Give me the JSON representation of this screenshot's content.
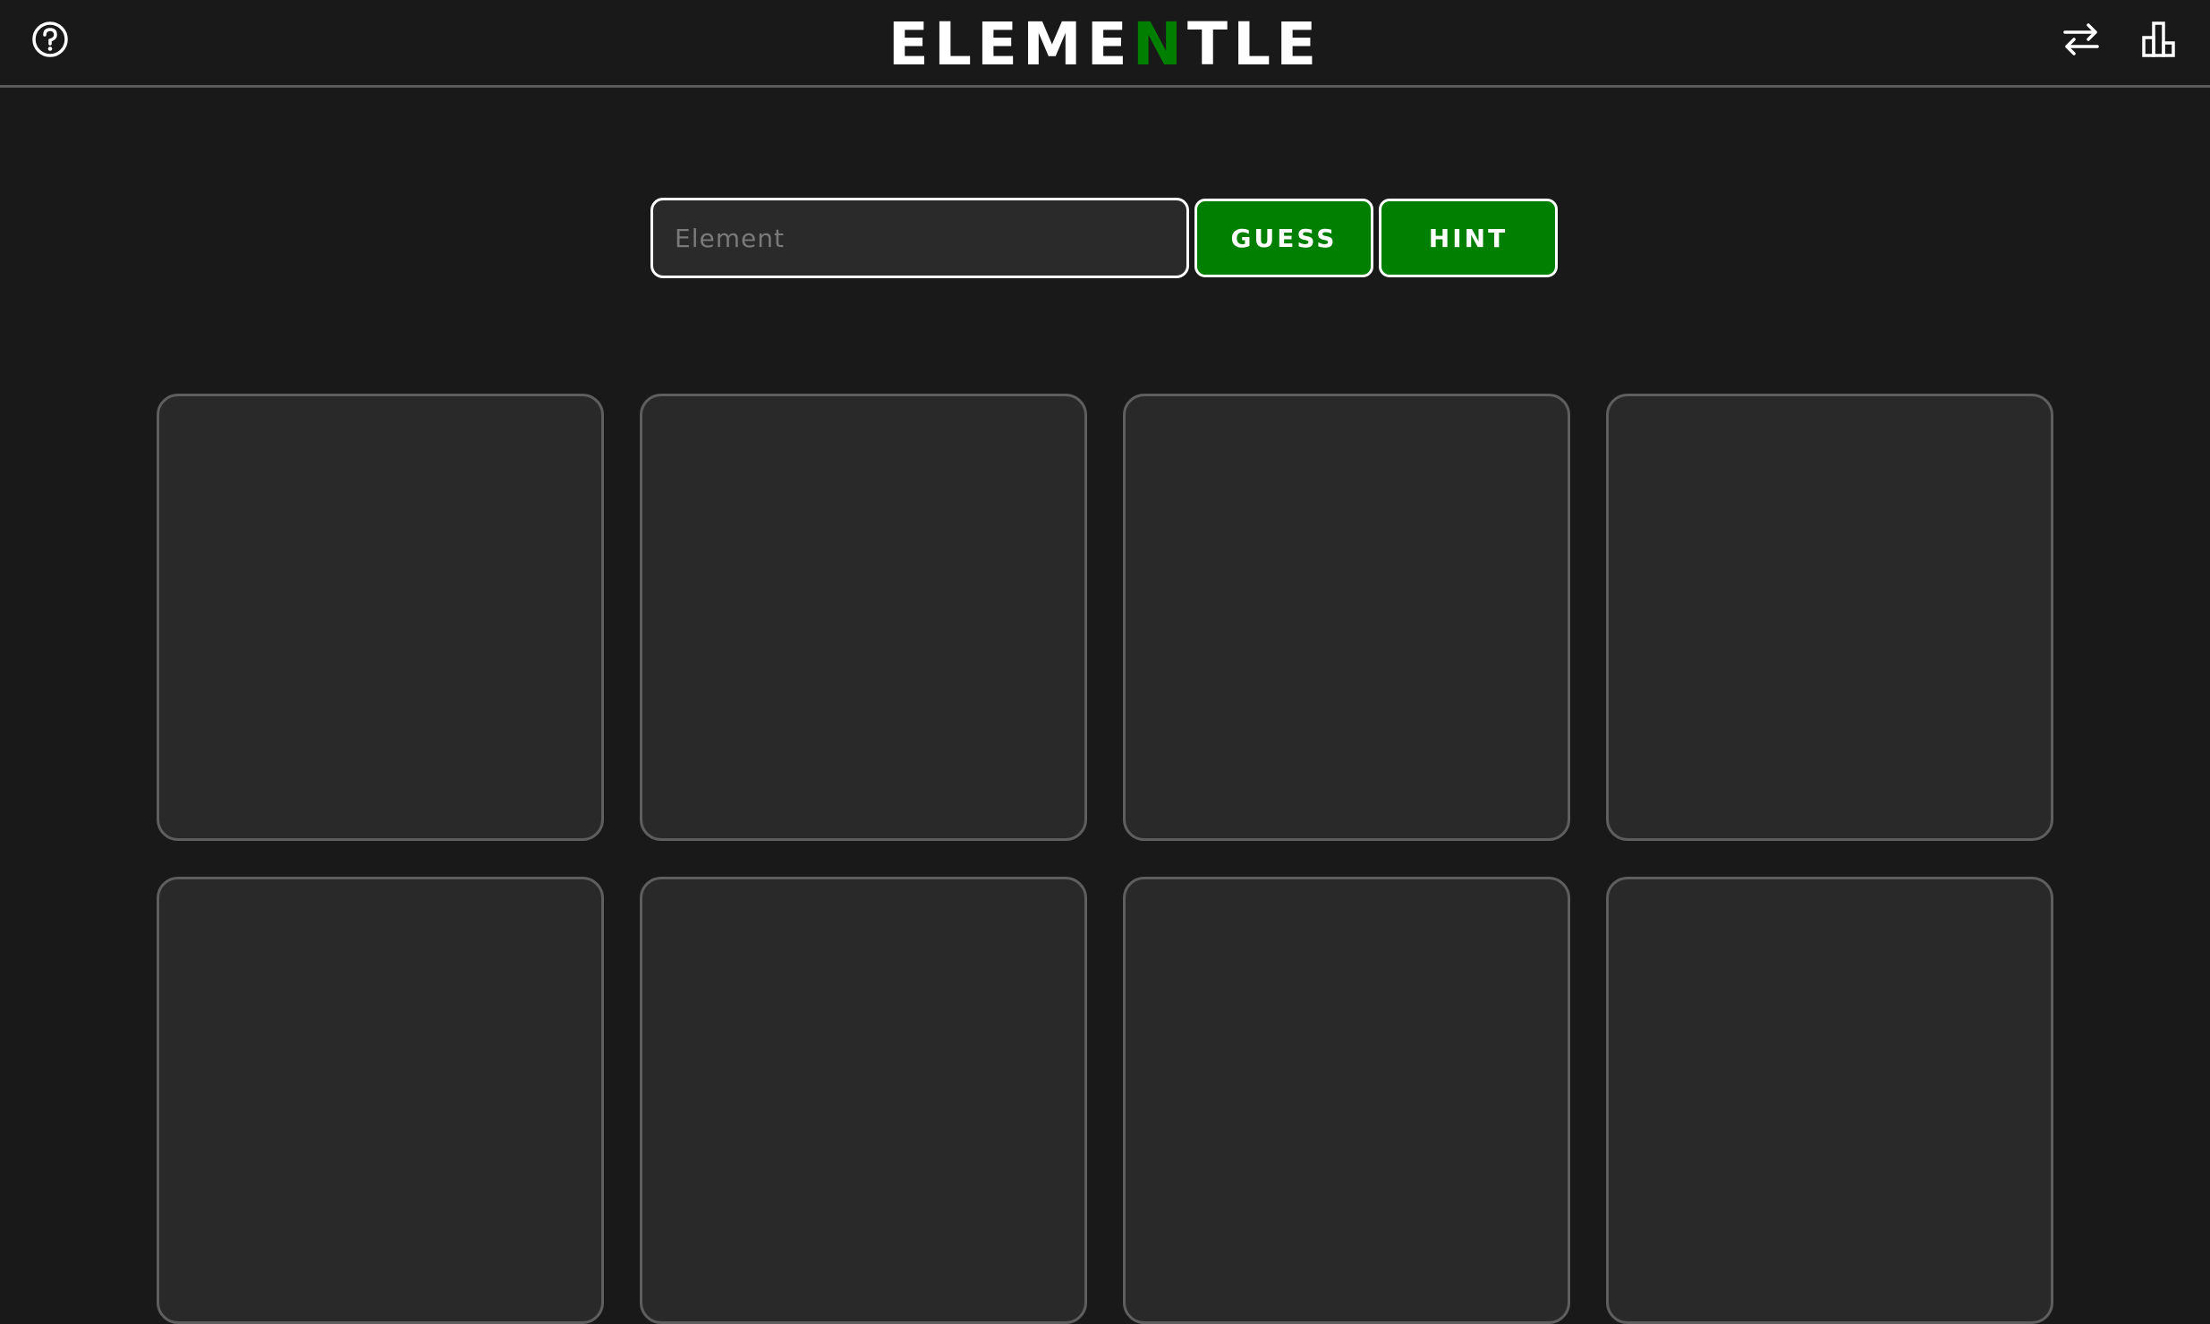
{
  "header": {
    "title_prefix": "ELEME",
    "title_highlight": "N",
    "title_suffix": "TLE",
    "accent_color": "#007f00",
    "left_icon": "help-icon",
    "right_icons": [
      "swap-icon",
      "stats-icon"
    ]
  },
  "guess_form": {
    "input_placeholder": "Element",
    "input_value": "",
    "guess_label": "GUESS",
    "hint_label": "HINT"
  },
  "tiles": {
    "visible_count": 8,
    "columns": 4
  }
}
